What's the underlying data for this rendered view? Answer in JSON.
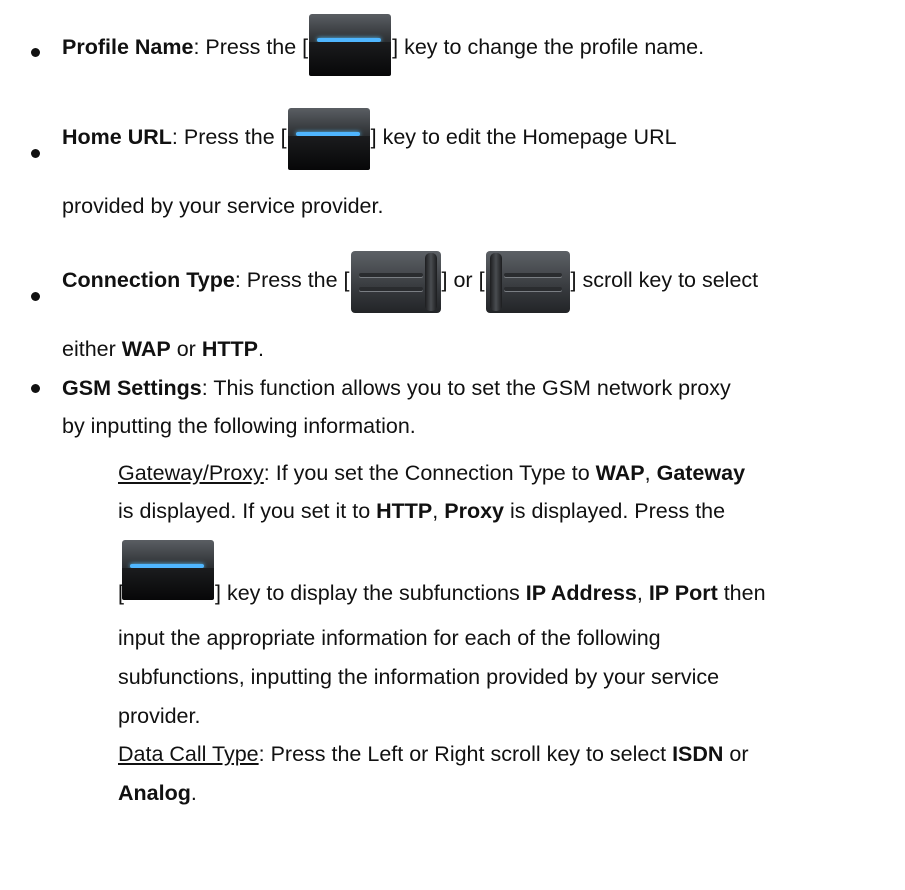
{
  "items": {
    "profile": {
      "label": "Profile Name",
      "before": ": Press the [",
      "after": "] key to change the profile name."
    },
    "home": {
      "label": "Home URL",
      "before": ": Press the [",
      "after": "] key to edit the Homepage URL",
      "line2": "provided by your service provider."
    },
    "connection": {
      "label": "Connection Type",
      "before": ": Press the [",
      "mid": "] or [",
      "after": "] scroll key to select",
      "line2_a": "either ",
      "wap": "WAP",
      "line2_b": " or ",
      "http": "HTTP",
      "line2_c": "."
    },
    "gsm": {
      "label": "GSM Settings",
      "text": ": This function allows you to set the GSM network proxy",
      "line2": "by inputting the following information."
    }
  },
  "gateway": {
    "title": "Gateway/Proxy",
    "l1a": ": If you set the Connection Type to ",
    "wap": "WAP",
    "l1b": ", ",
    "gateway_word": "Gateway",
    "l2a": "is displayed. If you set it to ",
    "http": "HTTP",
    "l2b": ", ",
    "proxy": "Proxy",
    "l2c": " is displayed. Press the",
    "bracket": "[",
    "l3a": "] key to display the subfunctions ",
    "ip_address": "IP Address",
    "l3b": ", ",
    "ip_port": "IP Port",
    "l3c": " then",
    "l4": "input the appropriate information for each of the following",
    "l5": "subfunctions, inputting the information provided by your service",
    "l6": "provider."
  },
  "datacall": {
    "title": "Data Call Type",
    "l1": ": Press the Left or Right scroll key to select ",
    "isdn": "ISDN",
    "l1b": " or",
    "analog": "Analog",
    "l2b": "."
  }
}
